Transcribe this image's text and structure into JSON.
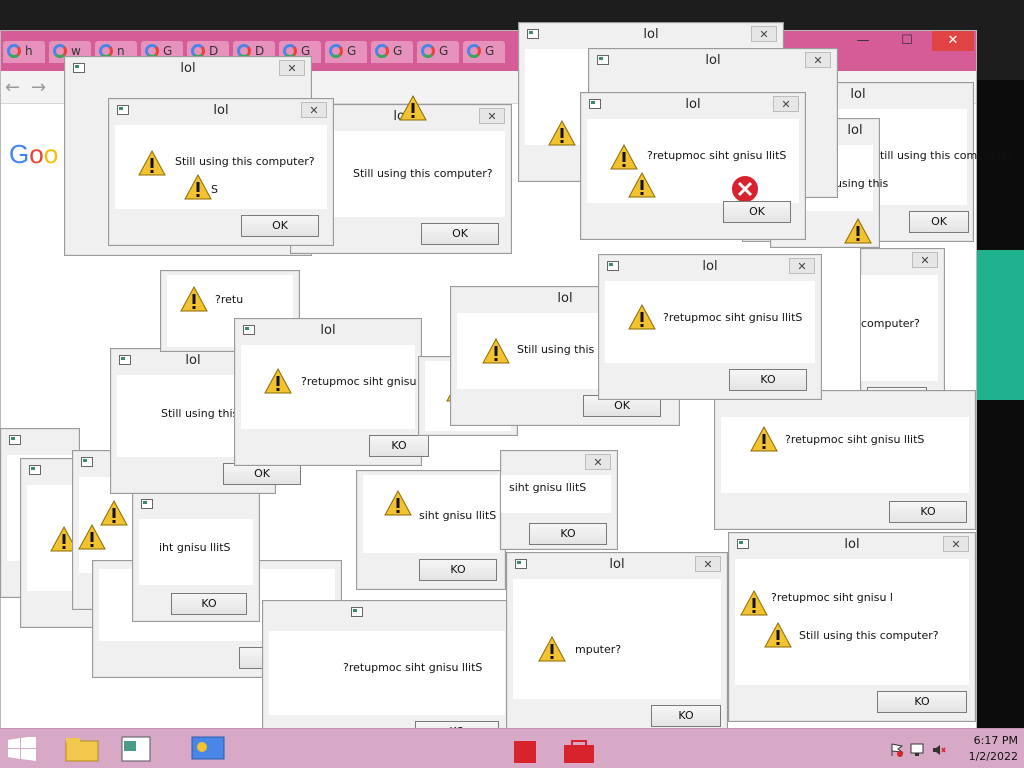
{
  "chrome": {
    "tabs": [
      {
        "label": "h"
      },
      {
        "label": "w"
      },
      {
        "label": "n"
      },
      {
        "label": "G"
      },
      {
        "label": "D"
      },
      {
        "label": "D"
      },
      {
        "label": "G"
      },
      {
        "label": "G"
      },
      {
        "label": "G"
      },
      {
        "label": "G"
      },
      {
        "label": "G"
      }
    ],
    "back_glyph": "←",
    "forward_glyph": "→",
    "google_logo": [
      "G",
      "o",
      "o"
    ]
  },
  "window_controls": {
    "minimize": "—",
    "maximize": "☐",
    "close": "✕"
  },
  "dialog_title": "lol",
  "close_glyph": "✕",
  "dialogs": [
    {
      "msg": "Still using this computer?",
      "btn": "OK"
    },
    {
      "msg": "Still using this computer?",
      "btn": "OK"
    },
    {
      "msg": "?retupmoc siht gnisu llitS",
      "btn": "OK"
    },
    {
      "msg": "?retupmoc siht gnisu llitS",
      "btn": "KO"
    },
    {
      "msg": "Still using this computer?",
      "btn": "OK"
    },
    {
      "msg": "?retupmoc siht gnisu llitS",
      "btn": "KO"
    },
    {
      "msg": "Still using this co",
      "btn": "OK"
    },
    {
      "msg": "?retupmoc siht gnisu llitS",
      "btn": "KO"
    },
    {
      "msg": "?retupmoc siht gnisu llitS",
      "btn": "KO"
    },
    {
      "msg": "iht gnisu llitS",
      "btn": "KO"
    },
    {
      "msg": "?retupmoc siht gnisu llitS",
      "btn": "KO"
    },
    {
      "msg": "?retupmoc siht gnisu llitS",
      "btn": "KO"
    },
    {
      "msg": "?retupmoc siht gnisu llitS",
      "btn": "KO"
    },
    {
      "msg": "?retupmoc siht gnisu llitS",
      "btn": "KO"
    },
    {
      "msg": "?retupmoc siht gnisu llitS",
      "btn": "KO"
    },
    {
      "msg": "?retupmoc siht gnisu llitS",
      "btn": "KO"
    },
    {
      "msg": "?retupmoc siht gnisu llitS",
      "btn": "KO"
    },
    {
      "msg": "mputer?",
      "btn": "OK"
    },
    {
      "msg": "?retupmoc siht gnisu llitS",
      "btn": "KO"
    },
    {
      "msg": "Still using this computer?",
      "btn": "OK"
    }
  ],
  "fragments": {
    "still_using_this": "Still using this",
    "still_using_this_computer": "Still using this computer?",
    "computer": "computer?",
    "retu": "?retu",
    "siht_gnisu_llits": "siht gnisu llitS",
    "retupmoc_siht_gnisu_l": "?retupmoc siht gnisu l",
    "ok": "OK",
    "ko": "KO",
    "s": "S"
  },
  "taskbar": {
    "time": "6:17 PM",
    "date": "1/2/2022",
    "items": [
      "start",
      "file-explorer",
      "window-app",
      "control-panel"
    ]
  },
  "colors": {
    "chrome_tabs": "#d65c98",
    "taskbar": "#d8a9c7",
    "warn": "#f2c230",
    "error": "#d8222c"
  }
}
